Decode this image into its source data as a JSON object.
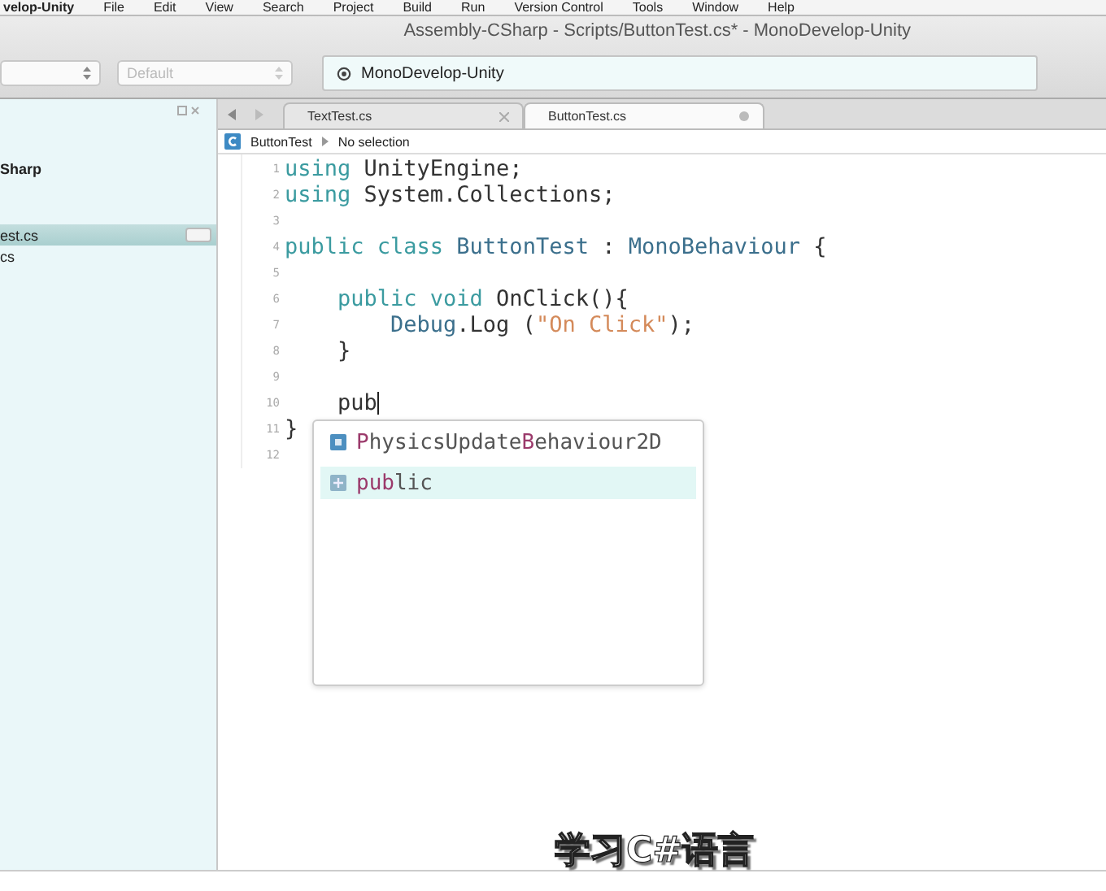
{
  "menu_bar": {
    "app_name": "velop-Unity",
    "items": [
      "File",
      "Edit",
      "View",
      "Search",
      "Project",
      "Build",
      "Run",
      "Version Control",
      "Tools",
      "Window",
      "Help"
    ]
  },
  "window": {
    "title": "Assembly-CSharp - Scripts/ButtonTest.cs* - MonoDevelop-Unity"
  },
  "toolbar": {
    "target_dropdown": {
      "value": "Default",
      "disabled": true
    },
    "status": "MonoDevelop-Unity"
  },
  "solution_pad": {
    "project": "Sharp",
    "items": [
      {
        "label": "est.cs",
        "selected": true
      },
      {
        "label": "cs",
        "selected": false
      }
    ]
  },
  "tabs": [
    {
      "label": "TextTest.cs",
      "selected": false
    },
    {
      "label": "ButtonTest.cs",
      "selected": true
    }
  ],
  "breadcrumb": {
    "class": "ButtonTest",
    "member": "No selection"
  },
  "code_lines": [
    {
      "number": "1",
      "tokens": [
        {
          "kind": "keyword",
          "text": "using"
        },
        {
          "kind": "plain",
          "text": " UnityEngine;"
        }
      ]
    },
    {
      "number": "2",
      "tokens": [
        {
          "kind": "keyword",
          "text": "using"
        },
        {
          "kind": "plain",
          "text": " System.Collections;"
        }
      ]
    },
    {
      "number": "3"
    },
    {
      "number": "4",
      "tokens": [
        {
          "kind": "keyword",
          "text": "public class"
        },
        {
          "kind": "type",
          "text": " ButtonTest"
        },
        {
          "kind": "plain",
          "text": " : "
        },
        {
          "kind": "type",
          "text": "MonoBehaviour"
        },
        {
          "kind": "plain",
          "text": " {"
        }
      ]
    },
    {
      "number": "5"
    },
    {
      "number": "6",
      "tokens": [
        {
          "kind": "keyword",
          "text": "    public void"
        },
        {
          "kind": "plain",
          "text": " OnClick(){"
        }
      ]
    },
    {
      "number": "7",
      "tokens": [
        {
          "kind": "type",
          "text": "        Debug"
        },
        {
          "kind": "plain",
          "text": ".Log ("
        },
        {
          "kind": "string",
          "text": "\"On Click\""
        },
        {
          "kind": "plain",
          "text": ");"
        }
      ]
    },
    {
      "number": "8",
      "tokens": [
        {
          "kind": "plain",
          "text": "    }"
        }
      ]
    },
    {
      "number": "9"
    },
    {
      "number": "10",
      "tokens": [
        {
          "kind": "plain",
          "text": "    pub"
        }
      ],
      "cursor": true
    },
    {
      "number": "11",
      "tokens": [
        {
          "kind": "plain",
          "text": "}"
        }
      ]
    },
    {
      "number": "12"
    }
  ],
  "completion_list": [
    {
      "kind": "class",
      "selected": false,
      "segments": [
        {
          "text": "P",
          "match": true
        },
        {
          "text": "hysicsUpdate",
          "match": false
        },
        {
          "text": "B",
          "match": true
        },
        {
          "text": "ehaviour2D",
          "match": false
        }
      ]
    },
    {
      "kind": "keyword",
      "selected": true,
      "segments": [
        {
          "text": "pub",
          "match": true
        },
        {
          "text": "lic",
          "match": false
        }
      ]
    }
  ],
  "subtitle": "学习C#语言"
}
